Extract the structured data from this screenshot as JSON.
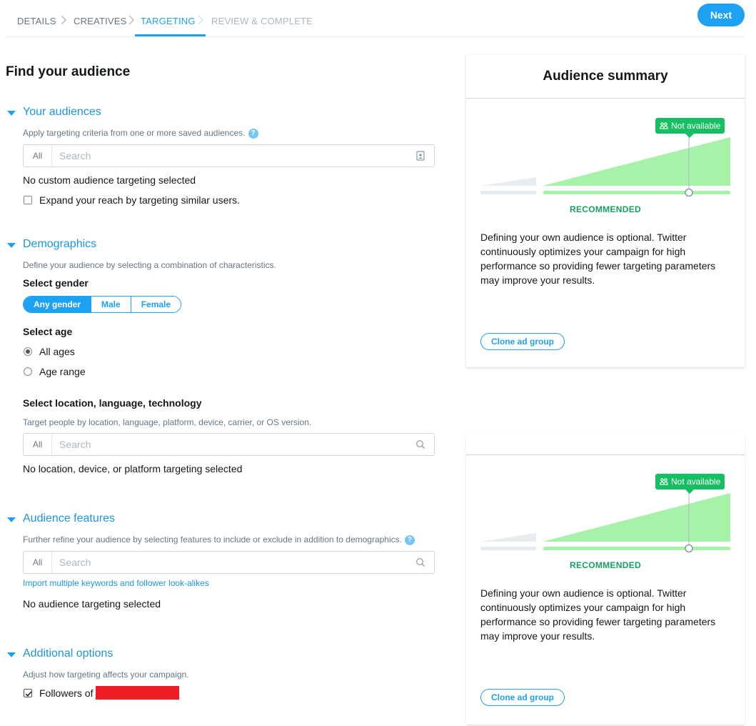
{
  "stepper": {
    "steps": [
      "DETAILS",
      "CREATIVES",
      "TARGETING",
      "REVIEW & COMPLETE"
    ],
    "active_index": 2,
    "next_label": "Next"
  },
  "page_title": "Find your audience",
  "your_audiences": {
    "title": "Your audiences",
    "desc": "Apply targeting criteria from one or more saved audiences.",
    "filter": "All",
    "placeholder": "Search",
    "empty": "No custom audience targeting selected",
    "expand_label": "Expand your reach by targeting similar users.",
    "expand_checked": false
  },
  "demographics": {
    "title": "Demographics",
    "desc": "Define your audience by selecting a combination of characteristics.",
    "gender_label": "Select gender",
    "gender_options": [
      "Any gender",
      "Male",
      "Female"
    ],
    "gender_selected": "Any gender",
    "age_label": "Select age",
    "age_options": [
      "All ages",
      "Age range"
    ],
    "age_selected": "All ages",
    "location_label": "Select location, language, technology",
    "location_desc": "Target people by location, language, platform, device, carrier, or OS version.",
    "filter": "All",
    "placeholder": "Search",
    "empty": "No location, device, or platform targeting selected"
  },
  "audience_features": {
    "title": "Audience features",
    "desc": "Further refine your audience by selecting features to include or exclude in addition to demographics.",
    "filter": "All",
    "placeholder": "Search",
    "import_link": "Import multiple keywords and follower look-alikes",
    "empty": "No audience targeting selected"
  },
  "additional_options": {
    "title": "Additional options",
    "desc": "Adjust how targeting affects your campaign.",
    "followers_label": "Followers of",
    "followers_checked": true
  },
  "summary": {
    "title": "Audience summary",
    "badge": "Not available",
    "recommended": "RECOMMENDED",
    "text": "Defining your own audience is optional. Twitter continuously optimizes your campaign for high performance so providing fewer targeting parameters may improve your results.",
    "clone_label": "Clone ad group"
  },
  "colors": {
    "accent": "#1da1f2",
    "success": "#17bf63",
    "recommended_fill": "#a6f2a8",
    "redaction": "#ef1c24"
  }
}
